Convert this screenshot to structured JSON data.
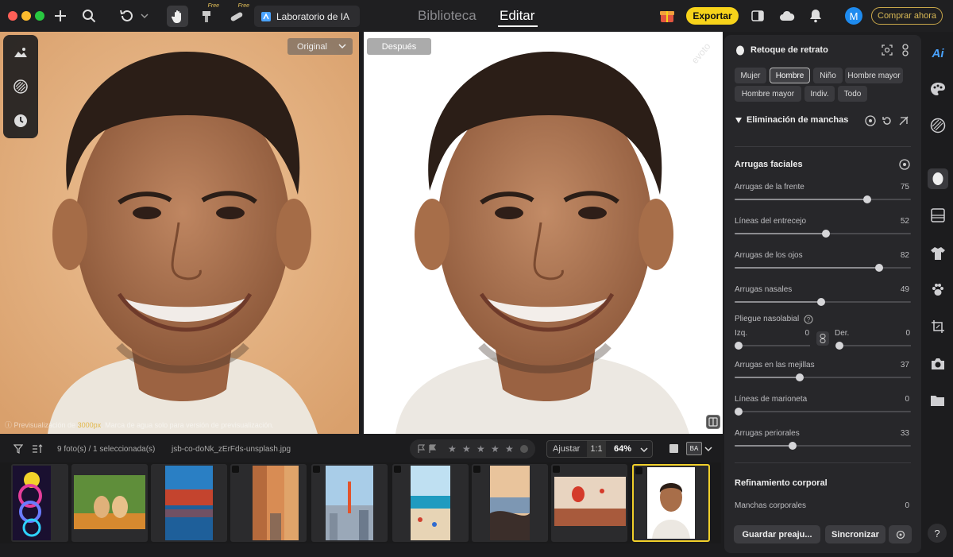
{
  "topbar": {
    "lab_label": "Laboratorio de IA",
    "free_tag": "Free",
    "tabs": [
      "Biblioteca",
      "Editar"
    ],
    "export_label": "Exportar",
    "avatar_initial": "M",
    "buy_label": "Comprar ahora"
  },
  "viewer": {
    "original_dropdown": "Original",
    "after_label": "Después",
    "watermark": "evoto",
    "preview_note_prefix": "Previsualización de",
    "preview_note_highlight": "3000px",
    "preview_note_suffix": ". Marca de agua solo para versión de previsualización."
  },
  "panel": {
    "title": "Retoque de retrato",
    "chips": [
      "Mujer",
      "Hombre",
      "Niño",
      "Hombre mayor",
      "Hombre mayor",
      "Indiv.",
      "Todo"
    ],
    "selected_chip": "Hombre",
    "section_manchas": "Eliminación de manchas",
    "section_arrugas": "Arrugas faciales",
    "sliders": [
      {
        "label": "Arrugas de la frente",
        "value": 75
      },
      {
        "label": "Líneas del entrecejo",
        "value": 52
      },
      {
        "label": "Arrugas de los ojos",
        "value": 82
      },
      {
        "label": "Arrugas nasales",
        "value": 49
      }
    ],
    "pliegue": {
      "label": "Pliegue nasolabial",
      "left_label": "Izq.",
      "left_value": 0,
      "right_label": "Der.",
      "right_value": 0
    },
    "sliders2": [
      {
        "label": "Arrugas en las mejillas",
        "value": 37
      },
      {
        "label": "Líneas de marioneta",
        "value": 0
      },
      {
        "label": "Arrugas periorales",
        "value": 33
      }
    ],
    "section_corporal": "Refinamiento corporal",
    "manchas_corporales": {
      "label": "Manchas corporales",
      "value": 0
    },
    "save_preset": "Guardar preaju...",
    "sync": "Sincronizar"
  },
  "rail": {
    "ai_label": "Ai",
    "help": "?"
  },
  "filmstrip": {
    "count": "9 foto(s) / 1 seleccionada(s)",
    "filename": "jsb-co-doNk_zErFds-unsplash.jpg",
    "fit_label": "Ajustar",
    "one_to_one": "1:1",
    "zoom": "64%",
    "ba_label": "BA",
    "thumbs": [
      "neon",
      "puppies",
      "harbor",
      "alley",
      "city",
      "beach",
      "sunset",
      "balloons",
      "portrait"
    ]
  },
  "colors": {
    "accent": "#f7d31a",
    "selected_border": "#f0cf2a",
    "avatar": "#1e8bef"
  }
}
